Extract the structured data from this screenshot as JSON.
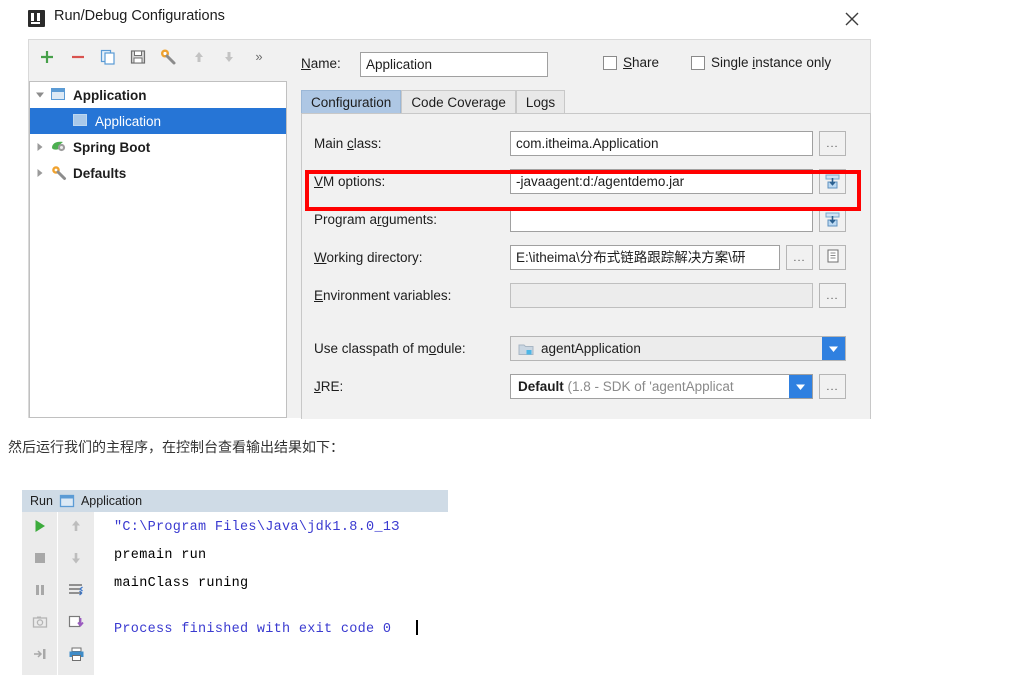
{
  "dialog": {
    "title": "Run/Debug Configurations",
    "title_icon": "intellij-idea-logo-icon",
    "close_icon": "close-icon",
    "toolbar": {
      "add_label": "+",
      "remove_label": "−",
      "copy_icon": "copy-icon",
      "save_icon": "save-icon",
      "edit_templates_icon": "wrench-icon",
      "move_up_icon": "arrow-up-icon",
      "move_down_icon": "arrow-down-icon",
      "more_label": "»"
    },
    "tree": [
      {
        "label": "Application",
        "icon": "application-icon",
        "expanded": true,
        "level": 0,
        "selected": false,
        "bold": true
      },
      {
        "label": "Application",
        "icon": "application-icon",
        "expanded": null,
        "level": 1,
        "selected": true,
        "bold": false
      },
      {
        "label": "Spring Boot",
        "icon": "spring-boot-icon",
        "expanded": false,
        "level": 0,
        "selected": false,
        "bold": true
      },
      {
        "label": "Defaults",
        "icon": "wrench-icon",
        "expanded": false,
        "level": 0,
        "selected": false,
        "bold": true
      }
    ],
    "name": {
      "label": "Name:",
      "value": "Application",
      "placeholder": ""
    },
    "checkboxes": [
      {
        "label": "Share",
        "checked": false
      },
      {
        "label": "Single instance only",
        "checked": false
      }
    ],
    "tabs": [
      {
        "label": "Configuration",
        "active": true
      },
      {
        "label": "Code Coverage",
        "active": false
      },
      {
        "label": "Logs",
        "active": false
      }
    ],
    "fields": [
      {
        "label": "Main class:",
        "value": "com.itheima.Application",
        "kind": "text",
        "trailing": [
          "browse-ellipsis-button"
        ]
      },
      {
        "label": "VM options:",
        "value": "-javaagent:d:/agentdemo.jar",
        "kind": "text",
        "trailing": [
          "insert-macro-button"
        ],
        "highlighted": true
      },
      {
        "label": "Program arguments:",
        "value": "",
        "kind": "text",
        "trailing": [
          "insert-macro-button"
        ]
      },
      {
        "label": "Working directory:",
        "value": "E:\\itheima\\分布式链路跟踪解决方案\\研",
        "kind": "text",
        "trailing": [
          "browse-ellipsis-button",
          "macro-list-button"
        ]
      },
      {
        "label": "Environment variables:",
        "value": "",
        "kind": "text-disabled",
        "trailing": [
          "browse-ellipsis-button"
        ]
      },
      {
        "label": "Use classpath of module:",
        "value": "agentApplication",
        "kind": "combo-module",
        "trailing": []
      },
      {
        "label": "JRE:",
        "value_bold": "Default",
        "value_grey": " (1.8 - SDK of 'agentApplicat",
        "kind": "combo-jre",
        "trailing": [
          "browse-ellipsis-button"
        ]
      }
    ],
    "highlight_color": "#ff0000",
    "selection_color": "#2675d6",
    "accent_color": "#2f80e0"
  },
  "caption": "然后运行我们的主程序，在控制台查看输出结果如下：",
  "console": {
    "header": {
      "run_label": "Run",
      "config_icon": "application-icon",
      "config_label": "Application"
    },
    "gutter_left": [
      "run-icon",
      "stop-icon",
      "pause-icon",
      "screenshot-icon",
      "dump-threads-icon"
    ],
    "gutter_right": [
      "arrow-up-icon",
      "arrow-down-icon",
      "soft-wrap-icon",
      "export-icon",
      "print-icon"
    ],
    "lines": [
      {
        "text": "\"C:\\Program Files\\Java\\jdk1.8.0_1З",
        "color": "blue"
      },
      {
        "text": "premain run",
        "color": "black"
      },
      {
        "text": "mainClass runing",
        "color": "black"
      },
      {
        "text": "Process finished with exit code 0",
        "color": "blue"
      }
    ],
    "caret_visible": true
  }
}
